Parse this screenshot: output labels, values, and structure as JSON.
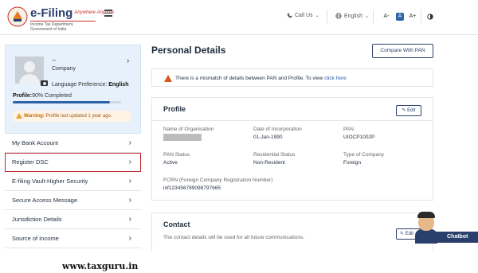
{
  "header": {
    "brand_title": "e-Filing",
    "brand_tagline": "Anywhere Anytime",
    "brand_subtitle": "Income Tax Department, Government of India",
    "call_us": "Call Us",
    "language": "English",
    "font_small": "A-",
    "font_default": "A",
    "font_large": "A+"
  },
  "profile_card": {
    "name": "--",
    "type": "Company",
    "language_label": "Language Preference:",
    "language_value": "English",
    "profile_label": "Profile:",
    "profile_value": "90% Completed",
    "profile_percent": 90,
    "warning_label": "Warning:",
    "warning_text": "Profile last updated 1 year ago."
  },
  "sidebar": {
    "items": [
      {
        "label": "My Bank Account"
      },
      {
        "label": "Register DSC"
      },
      {
        "label": "E-filing Vault-Higher Security"
      },
      {
        "label": "Secure Access Message"
      },
      {
        "label": "Jurisdiction Details"
      },
      {
        "label": "Source of Income"
      }
    ]
  },
  "main": {
    "page_title": "Personal Details",
    "compare_button": "Compare With PAN",
    "alert_text": "There is a mismatch of details between PAN and Profile. To view",
    "alert_link": "click here"
  },
  "profile_section": {
    "title": "Profile",
    "edit_label": "Edit",
    "fields": {
      "org_label": "Name of Organisation",
      "inc_label": "Date of Incorporation",
      "inc_value": "01-Jan-1990",
      "pan_label": "PAN",
      "pan_value": "UIOCP1002P",
      "pan_status_label": "PAN Status",
      "pan_status_value": "Active",
      "res_status_label": "Residential Status",
      "res_status_value": "Non-Resident",
      "company_type_label": "Type of Company",
      "company_type_value": "Foreign",
      "fcrn_label": "FCRN (Foreign Company Registration Number)",
      "fcrn_value": "inf123456789098797665"
    }
  },
  "contact_section": {
    "title": "Contact",
    "description": "The contact details will be used for all future communications.",
    "edit_label": "Edit"
  },
  "chatbot": {
    "label": "Chatbot"
  },
  "watermark": {
    "text": "www.taxguru.in"
  }
}
